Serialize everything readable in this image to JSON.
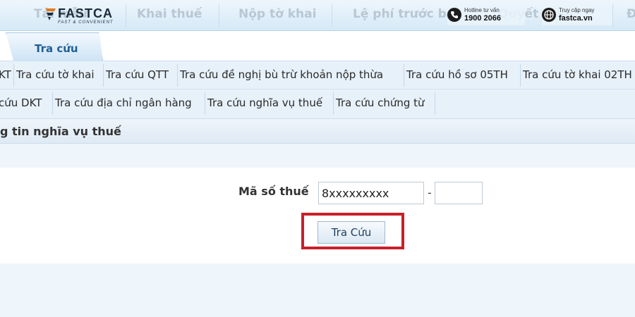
{
  "topnav": {
    "items": [
      "Tải mẫu",
      "Khai thuế",
      "Nộp tờ khai",
      "Lệ phí trước bạ",
      "Quyết toán",
      "Đ"
    ]
  },
  "logo": {
    "name": "FASTCA",
    "tagline": "FAST & CONVENIENT"
  },
  "contacts": [
    {
      "small": "Hotline tư vấn",
      "big": "1900 2066",
      "icon": "phone-icon"
    },
    {
      "small": "Truy cập ngay",
      "big": "fastca.vn",
      "icon": "globe-icon"
    }
  ],
  "tabs": {
    "active": "Tra cứu"
  },
  "submenu": {
    "row1": [
      "KT",
      "Tra cứu tờ khai",
      "Tra cứu QTT",
      "Tra cứu đề nghị bù trừ khoản nộp thừa",
      "Tra cứu hồ sơ 05TH",
      "Tra cứu tờ khai 02TH"
    ],
    "row2": [
      "cứu DKT",
      "Tra cứu địa chỉ ngân hàng",
      "Tra cứu nghĩa vụ thuế",
      "Tra cứu chứng từ"
    ]
  },
  "section": {
    "title": "g tin nghĩa vụ thuế"
  },
  "form": {
    "mst_label": "Mã số thuế",
    "mst_value": "8xxxxxxxxx",
    "separator": "-",
    "branch_value": "",
    "search_button": "Tra Cứu"
  },
  "colors": {
    "highlight": "#c8202a",
    "tab_text": "#1f5f96",
    "menu_background": "#e7f1fa"
  }
}
